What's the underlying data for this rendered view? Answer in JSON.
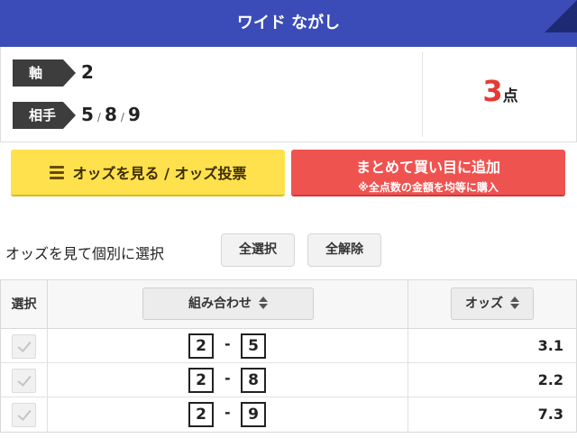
{
  "header": {
    "title": "ワイド ながし"
  },
  "summary": {
    "axis_label": "軸",
    "axis_value": "2",
    "partner_label": "相手",
    "partners": [
      "5",
      "8",
      "9"
    ],
    "partner_separator": "/",
    "points_count": "3",
    "points_unit": "点"
  },
  "actions": {
    "odds_button_label": "オッズを見る / オッズ投票",
    "add_button_main": "まとめて買い目に追加",
    "add_button_sub": "※全点数の金額を均等に購入"
  },
  "selection": {
    "heading": "オッズを見て個別に選択",
    "select_all_label": "全選択",
    "clear_all_label": "全解除"
  },
  "table": {
    "col_select": "選択",
    "col_combo": "組み合わせ",
    "col_odds": "オッズ",
    "combo_separator": "-",
    "rows": [
      {
        "a": "2",
        "b": "5",
        "odds": "3.1"
      },
      {
        "a": "2",
        "b": "8",
        "odds": "2.2"
      },
      {
        "a": "2",
        "b": "9",
        "odds": "7.3"
      }
    ]
  },
  "colors": {
    "header_bg": "#3b4cb8",
    "odds_button_bg": "#ffe14d",
    "add_button_bg": "#ef5350",
    "points_accent": "#e53935"
  }
}
